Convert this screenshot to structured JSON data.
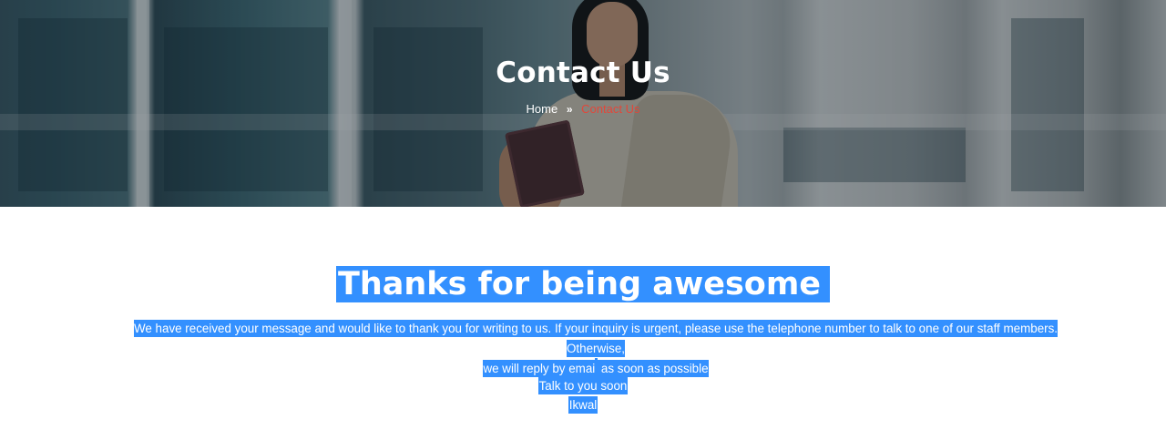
{
  "hero": {
    "title": "Contact Us",
    "breadcrumb": {
      "home": "Home",
      "separator": "»",
      "current": "Contact Us"
    }
  },
  "content": {
    "heading": "Thanks for being awesome",
    "message_line1": "We have received your message and would like to thank you for writing to us. If your inquiry is urgent, please use the telephone number to talk to one of our staff members. Otherwise,",
    "message_line2": "we will reply by email as soon as possible",
    "signoff": "Talk to you soon",
    "signature": "Ikwal"
  },
  "colors": {
    "selection": "#3390ff",
    "breadcrumb_active": "#e2473a"
  }
}
